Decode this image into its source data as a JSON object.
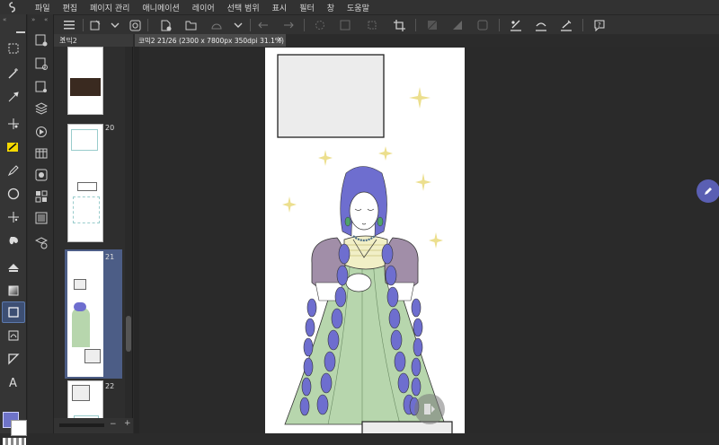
{
  "menu": {
    "items": [
      "파일",
      "편집",
      "페이지 관리",
      "애니메이션",
      "레이어",
      "선택 범위",
      "표시",
      "필터",
      "창",
      "도움말"
    ]
  },
  "page_panel": {
    "title": "코믹2",
    "page_numbers": [
      "20",
      "21",
      "22"
    ]
  },
  "document_tab": {
    "label": "코믹2 21/26 (2300 x 7800px 350dpi 31.1%)"
  },
  "colors": {
    "accent": "#5b79ad",
    "main_color": "#6e73c9",
    "sub_color": "#ffffff",
    "dress": "#b7d6ad",
    "hair": "#6e6ecf",
    "sleeve": "#a18ea8",
    "sparkle": "#e8d97a"
  },
  "icons": {
    "logo": "clip-studio-logo-icon",
    "tools": [
      "marquee-icon",
      "magic-wand-icon",
      "eyedropper-icon",
      "move-icon",
      "brush-icon",
      "pen-icon",
      "circle-figure-icon",
      "sparkle-tool-icon",
      "blend-icon",
      "fill-icon",
      "gradient-icon",
      "rect-frame-icon",
      "correct-icon",
      "ruler-icon",
      "text-icon"
    ],
    "sub_tools": [
      "page-settings-icon",
      "page-add-icon",
      "layers-icon",
      "navigator-icon",
      "timeline-icon",
      "material-icon",
      "history-icon",
      "info-icon",
      "auto-actions-icon"
    ],
    "command_bar": [
      "menu-icon",
      "new-file-icon",
      "open-icon",
      "save-icon",
      "undo-icon",
      "redo-icon",
      "deselect-icon",
      "invert-icon",
      "crop-icon",
      "show-area-icon",
      "correct-line-icon",
      "rotate-icon",
      "ruler-toggle-icon",
      "settings-icon",
      "help-icon"
    ]
  }
}
